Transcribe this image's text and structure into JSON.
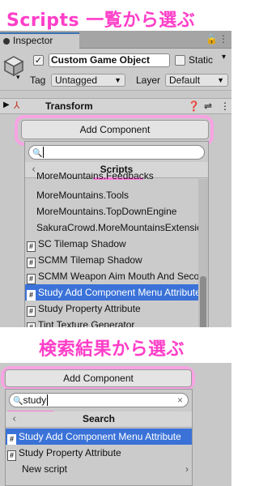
{
  "captions": {
    "top": "Scripts 一覧から選ぶ",
    "middle": "検索結果から選ぶ"
  },
  "inspector": {
    "tab_label": "Inspector",
    "object_name": "Custom Game Object",
    "static_label": "Static",
    "tag_label": "Tag",
    "tag_value": "Untagged",
    "layer_label": "Layer",
    "layer_value": "Default",
    "component_name": "Transform"
  },
  "top_panel": {
    "add_component_label": "Add Component",
    "search_value": "",
    "header_title": "Scripts",
    "items": [
      {
        "label": "MoreMountains.Feedbacks",
        "script": false,
        "selected": false
      },
      {
        "label": "MoreMountains.Tools",
        "script": false,
        "selected": false
      },
      {
        "label": "MoreMountains.TopDownEngine",
        "script": false,
        "selected": false
      },
      {
        "label": "SakuraCrowd.MoreMountainsExtensions",
        "script": false,
        "selected": false
      },
      {
        "label": "SC Tilemap Shadow",
        "script": true,
        "selected": false
      },
      {
        "label": "SCMM Tilemap Shadow",
        "script": true,
        "selected": false
      },
      {
        "label": "SCMM Weapon Aim Mouth And Secondary Stick",
        "script": true,
        "selected": false
      },
      {
        "label": "Study Add Component Menu Attribute",
        "script": true,
        "selected": true
      },
      {
        "label": "Study Property Attribute",
        "script": true,
        "selected": false
      },
      {
        "label": "Tint Texture Generator",
        "script": true,
        "selected": false
      }
    ]
  },
  "bottom_panel": {
    "add_component_label": "Add Component",
    "search_value": "study",
    "header_title": "Search",
    "items": [
      {
        "label": "Study Add Component Menu Attribute",
        "script": true,
        "selected": true
      },
      {
        "label": "Study Property Attribute",
        "script": true,
        "selected": false
      },
      {
        "label": "New script",
        "script": false,
        "selected": false
      }
    ]
  },
  "colors": {
    "accent_pink": "#ff3ec8",
    "highlight_ring": "#f8a3e3",
    "selection_blue": "#3a72d8"
  }
}
